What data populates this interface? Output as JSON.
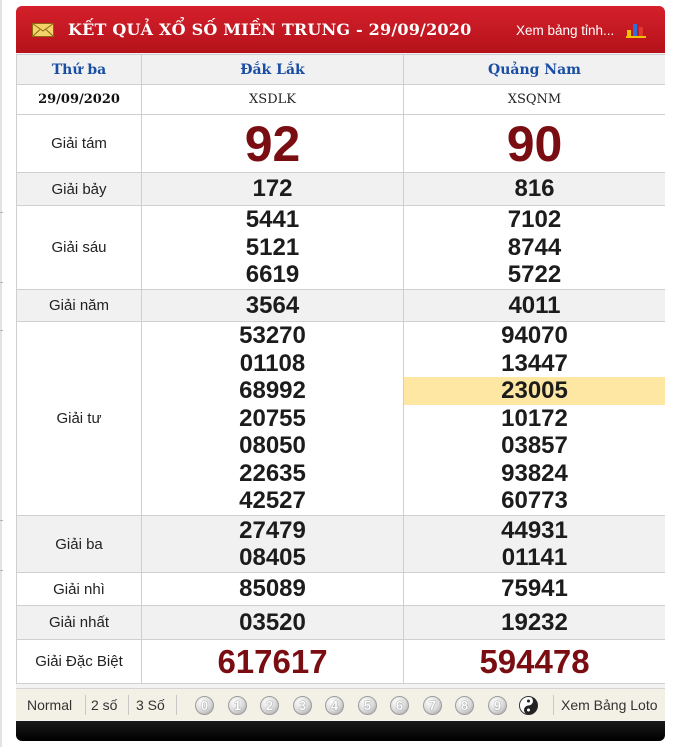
{
  "header": {
    "title": "KẾT QUẢ XỔ SỐ MIỀN TRUNG - 29/09/2020",
    "view_table_link": "Xem bảng tỉnh...",
    "mail_icon": "envelope-icon",
    "chart_icon": "bar-chart-icon"
  },
  "table": {
    "day": "Thứ ba",
    "date": "29/09/2020",
    "provinces": [
      {
        "name": "Đắk Lắk",
        "code": "XSDLK"
      },
      {
        "name": "Quảng Nam",
        "code": "XSQNM"
      }
    ],
    "prizes": [
      {
        "label": "Giải tám",
        "values": [
          [
            "92"
          ],
          [
            "90"
          ]
        ]
      },
      {
        "label": "Giải bảy",
        "values": [
          [
            "172"
          ],
          [
            "816"
          ]
        ]
      },
      {
        "label": "Giải sáu",
        "values": [
          [
            "5441",
            "5121",
            "6619"
          ],
          [
            "7102",
            "8744",
            "5722"
          ]
        ]
      },
      {
        "label": "Giải năm",
        "values": [
          [
            "3564"
          ],
          [
            "4011"
          ]
        ]
      },
      {
        "label": "Giải tư",
        "values": [
          [
            "53270",
            "01108",
            "68992",
            "20755",
            "08050",
            "22635",
            "42527"
          ],
          [
            "94070",
            "13447",
            "23005",
            "10172",
            "03857",
            "93824",
            "60773"
          ]
        ]
      },
      {
        "label": "Giải ba",
        "values": [
          [
            "27479",
            "08405"
          ],
          [
            "44931",
            "01141"
          ]
        ]
      },
      {
        "label": "Giải nhì",
        "values": [
          [
            "85089"
          ],
          [
            "75941"
          ]
        ]
      },
      {
        "label": "Giải nhất",
        "values": [
          [
            "03520"
          ],
          [
            "19232"
          ]
        ]
      },
      {
        "label": "Giải Đặc Biệt",
        "values": [
          [
            "617617"
          ],
          [
            "594478"
          ]
        ]
      }
    ],
    "highlighted_number": "23005",
    "highlight_color": "#fde7a3"
  },
  "toolbar": {
    "modes": [
      "Normal",
      "2 số",
      "3 Số"
    ],
    "digits": [
      "0",
      "1",
      "2",
      "3",
      "4",
      "5",
      "6",
      "7",
      "8",
      "9"
    ],
    "yinyang_icon": "yin-yang-icon",
    "loto_link": "Xem Bảng Loto"
  },
  "colors": {
    "header_red": "#c81922",
    "prize_red": "#7a0d12",
    "province_blue": "#1a4ea3"
  }
}
